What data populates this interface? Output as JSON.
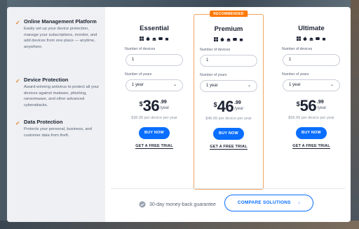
{
  "features": [
    {
      "title": "Online Management Platform",
      "desc": "Easily set up your device protection, manage your subscriptions, monitor, and add devices from one place — anytime, anywhere."
    },
    {
      "title": "Device Protection",
      "desc": "Award-winning antivirus to protect all your devices against malware, phishing, ransomware, and other advanced cyberattacks."
    },
    {
      "title": "Data Protection",
      "desc": "Protects your personal, business, and customer data from theft."
    }
  ],
  "plans": [
    {
      "name": "Essential",
      "devices_label": "Number of devices",
      "devices_value": "1",
      "years_label": "Number of years",
      "years_value": "1 year",
      "currency": "$",
      "price_int": "36",
      "price_dec": ".99",
      "per": "/year",
      "per_device": "$36.99 per device per year",
      "buy": "BUY NOW",
      "trial": "GET A FREE TRIAL"
    },
    {
      "name": "Premium",
      "badge": "RECOMMENDED",
      "devices_label": "Number of devices",
      "devices_value": "1",
      "years_label": "Number of years",
      "years_value": "1 year",
      "currency": "$",
      "price_int": "46",
      "price_dec": ".99",
      "per": "/year",
      "per_device": "$46.99 per device per year",
      "buy": "BUY NOW",
      "trial": "GET A FREE TRIAL"
    },
    {
      "name": "Ultimate",
      "devices_label": "Number of devices",
      "devices_value": "1",
      "years_label": "Number of years",
      "years_value": "1 year",
      "currency": "$",
      "price_int": "56",
      "price_dec": ".99",
      "per": "/year",
      "per_device": "$56.99 per device per year",
      "buy": "BUY NOW",
      "trial": "GET A FREE TRIAL"
    }
  ],
  "os_icons": [
    "windows-icon",
    "apple-icon",
    "android-icon",
    "ios-icon",
    "chromebook-icon"
  ],
  "footer": {
    "guarantee": "30-day money-back guarantee",
    "compare": "COMPARE SOLUTIONS"
  },
  "colors": {
    "accent": "#0a6eff",
    "badge": "#ff7800",
    "check": "#e8842a"
  }
}
